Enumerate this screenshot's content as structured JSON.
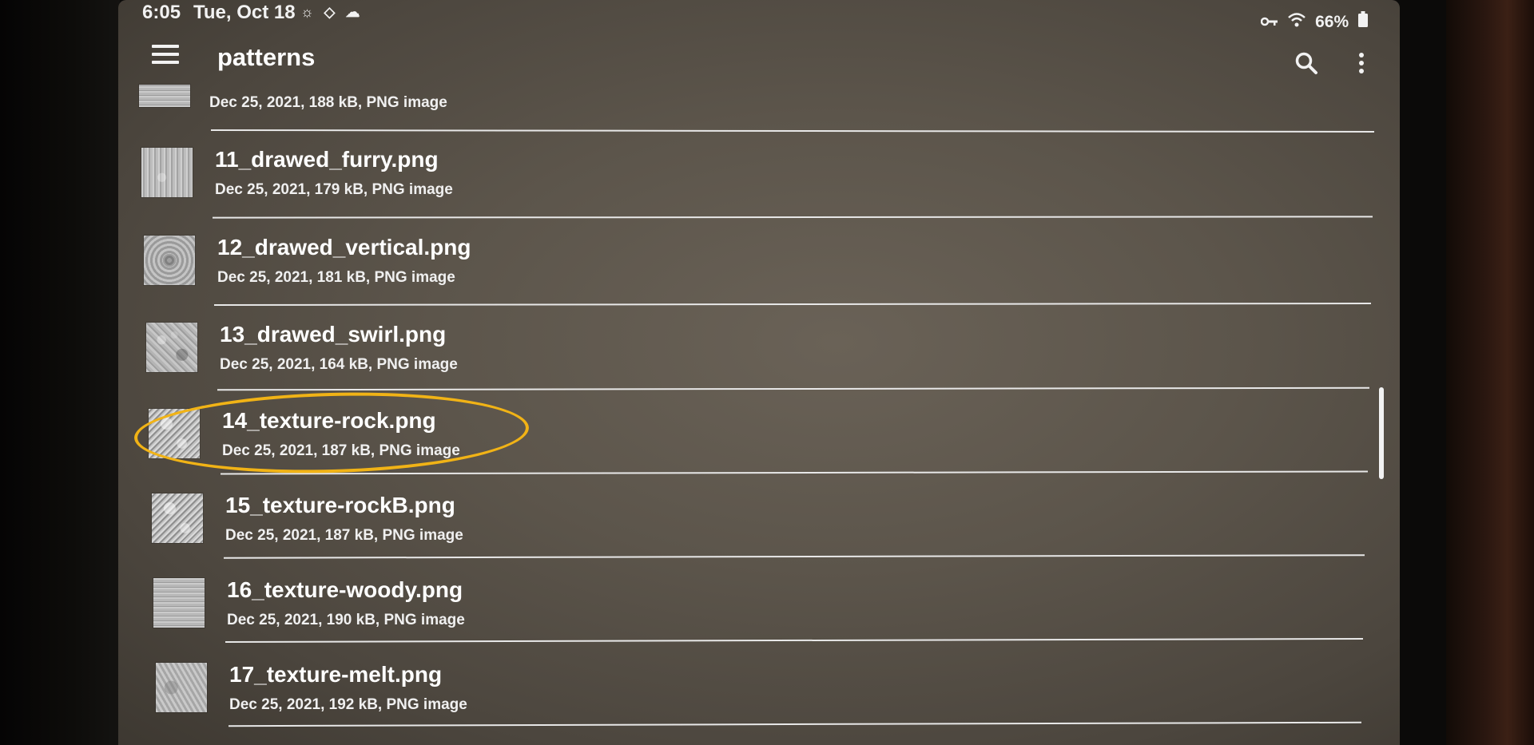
{
  "status_bar": {
    "time": "6:05",
    "date": "Tue, Oct 18",
    "weather_icons": "☼ ◇ ☁",
    "battery": "66%"
  },
  "app_bar": {
    "title": "patterns"
  },
  "files": [
    {
      "name": "",
      "meta": "Dec 25, 2021, 188 kB, PNG image",
      "thumb": "texture"
    },
    {
      "name": "11_drawed_furry.png",
      "meta": "Dec 25, 2021, 179 kB, PNG image",
      "thumb": "texture"
    },
    {
      "name": "12_drawed_vertical.png",
      "meta": "Dec 25, 2021, 181 kB, PNG image",
      "thumb": "texture"
    },
    {
      "name": "13_drawed_swirl.png",
      "meta": "Dec 25, 2021, 164 kB, PNG image",
      "thumb": "texture"
    },
    {
      "name": "14_texture-rock.png",
      "meta": "Dec 25, 2021, 187 kB, PNG image",
      "thumb": "texture",
      "highlighted": true
    },
    {
      "name": "15_texture-rockB.png",
      "meta": "Dec 25, 2021, 187 kB, PNG image",
      "thumb": "texture"
    },
    {
      "name": "16_texture-woody.png",
      "meta": "Dec 25, 2021, 190 kB, PNG image",
      "thumb": "texture"
    },
    {
      "name": "17_texture-melt.png",
      "meta": "Dec 25, 2021, 192 kB, PNG image",
      "thumb": "texture"
    }
  ],
  "colors": {
    "highlight": "#f1b316",
    "background": "#5c554b",
    "text": "#ffffff"
  },
  "icons": [
    "menu-icon",
    "search-icon",
    "more-vert-icon",
    "wifi-icon",
    "vpn-key-icon",
    "battery-icon"
  ]
}
